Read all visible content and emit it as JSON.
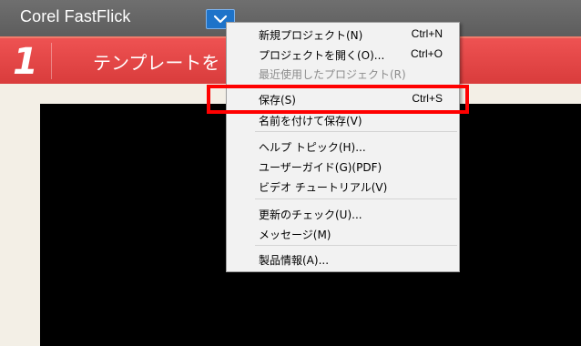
{
  "app": {
    "title": "Corel FastFlick"
  },
  "step": {
    "number": "1",
    "title": "テンプレートを"
  },
  "menu": {
    "items": [
      {
        "label": "新規プロジェクト(N)",
        "shortcut": "Ctrl+N"
      },
      {
        "label": "プロジェクトを開く(O)...",
        "shortcut": "Ctrl+O"
      },
      {
        "label": "最近使用したプロジェクト(R)",
        "shortcut": ""
      },
      {
        "label": "保存(S)",
        "shortcut": "Ctrl+S"
      },
      {
        "label": "名前を付けて保存(V)",
        "shortcut": ""
      },
      {
        "label": "ヘルプ トピック(H)...",
        "shortcut": ""
      },
      {
        "label": "ユーザーガイド(G)(PDF)",
        "shortcut": ""
      },
      {
        "label": "ビデオ チュートリアル(V)",
        "shortcut": ""
      },
      {
        "label": "更新のチェック(U)...",
        "shortcut": ""
      },
      {
        "label": "メッセージ(M)",
        "shortcut": ""
      },
      {
        "label": "製品情報(A)...",
        "shortcut": ""
      }
    ]
  },
  "colors": {
    "titlebar": "#636363",
    "step_banner": "#e44848",
    "menu_button": "#1e73c9",
    "highlight": "#ff0000"
  }
}
